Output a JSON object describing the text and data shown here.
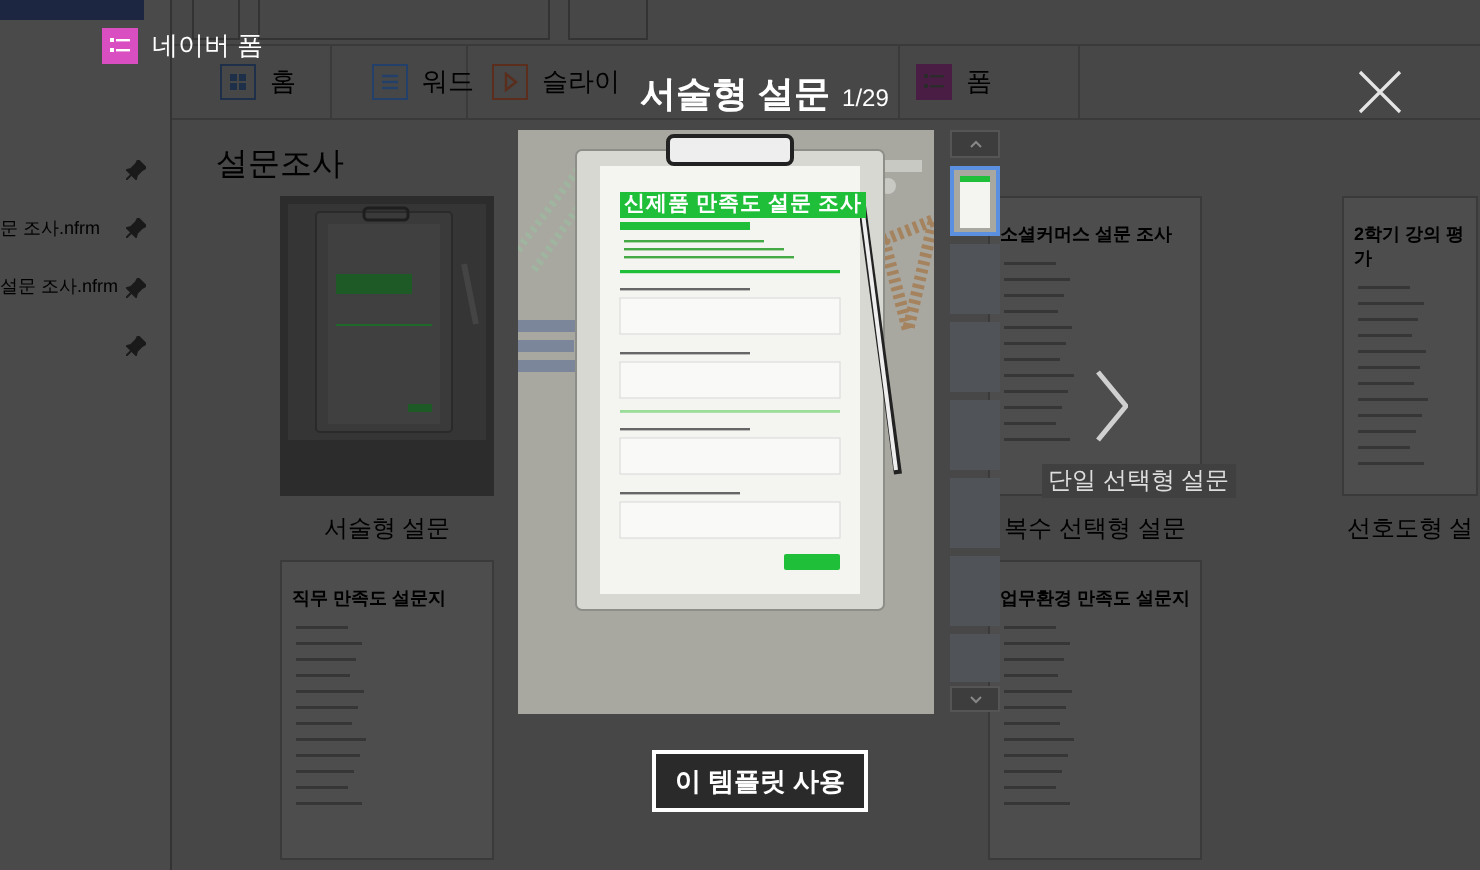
{
  "sidebar": {
    "items": [
      {
        "pinned": true
      },
      {
        "label": "문 조사.nfrm",
        "pinned": true
      },
      {
        "label": "설문 조사.nfrm",
        "pinned": true
      },
      {
        "pinned": true
      }
    ]
  },
  "app_tabs": [
    {
      "kind": "home",
      "label": "홈"
    },
    {
      "kind": "word",
      "label": "워드"
    },
    {
      "kind": "slide",
      "label": "슬라이"
    },
    {
      "kind": "form",
      "label": "폼"
    }
  ],
  "section_title": "설문조사",
  "template_rows": [
    [
      {
        "kind": "clipboard",
        "label": "서술형 설문"
      },
      null,
      {
        "kind": "document",
        "title": "소셜커머스 설문 조사",
        "label": "복수 선택형 설문"
      },
      {
        "kind": "document",
        "title": "2학기 강의 평가",
        "label": "선호도형 설"
      }
    ],
    [
      {
        "kind": "document",
        "title": "직무 만족도 설문지"
      },
      null,
      {
        "kind": "document",
        "title": "업무환경 만족도 설문지"
      }
    ]
  ],
  "modal": {
    "app_name": "네이버 폼",
    "title": "서술형 설문",
    "counter": "1/29",
    "preview": {
      "form_title": "신제품 만족도 설문 조사"
    },
    "thumbnails": [
      {
        "selected": true
      },
      {
        "selected": false
      },
      {
        "selected": false
      },
      {
        "selected": false
      },
      {
        "selected": false
      },
      {
        "selected": false
      },
      {
        "selected": false
      }
    ],
    "next_caption": "단일 선택형 설문",
    "use_button": "이 템플릿 사용"
  }
}
